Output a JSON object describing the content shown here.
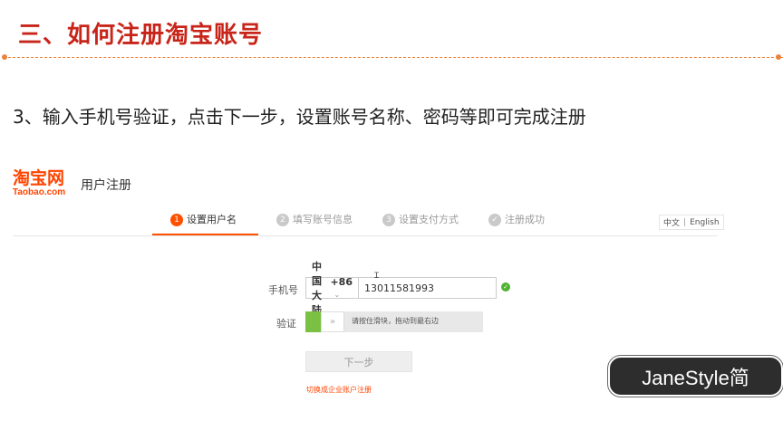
{
  "slide": {
    "title": "三、如何注册淘宝账号",
    "body": "3、输入手机号验证，点击下一步，设置账号名称、密码等即可完成注册"
  },
  "header": {
    "logo_cn": "淘宝网",
    "logo_en": "Taobao.com",
    "label": "用户注册"
  },
  "steps": [
    {
      "num": "1",
      "label": "设置用户名",
      "active": true
    },
    {
      "num": "2",
      "label": "填写账号信息",
      "active": false
    },
    {
      "num": "3",
      "label": "设置支付方式",
      "active": false
    },
    {
      "num": "✓",
      "label": "注册成功",
      "active": false
    }
  ],
  "lang": {
    "cn": "中文",
    "sep": "|",
    "en": "English"
  },
  "form": {
    "phone_label": "手机号",
    "country": "中国大陆",
    "country_code": "+86",
    "phone_value": "13011581993",
    "verify_label": "验证",
    "slider_text": "请按住滑块，拖动到最右边",
    "slider_handle": "»",
    "next_button": "下一步",
    "switch_link": "切换成企业账户注册"
  },
  "watermark": "JaneStyle简",
  "colors": {
    "accent": "#ff5000",
    "title": "#c8251a",
    "success": "#4fb233"
  }
}
